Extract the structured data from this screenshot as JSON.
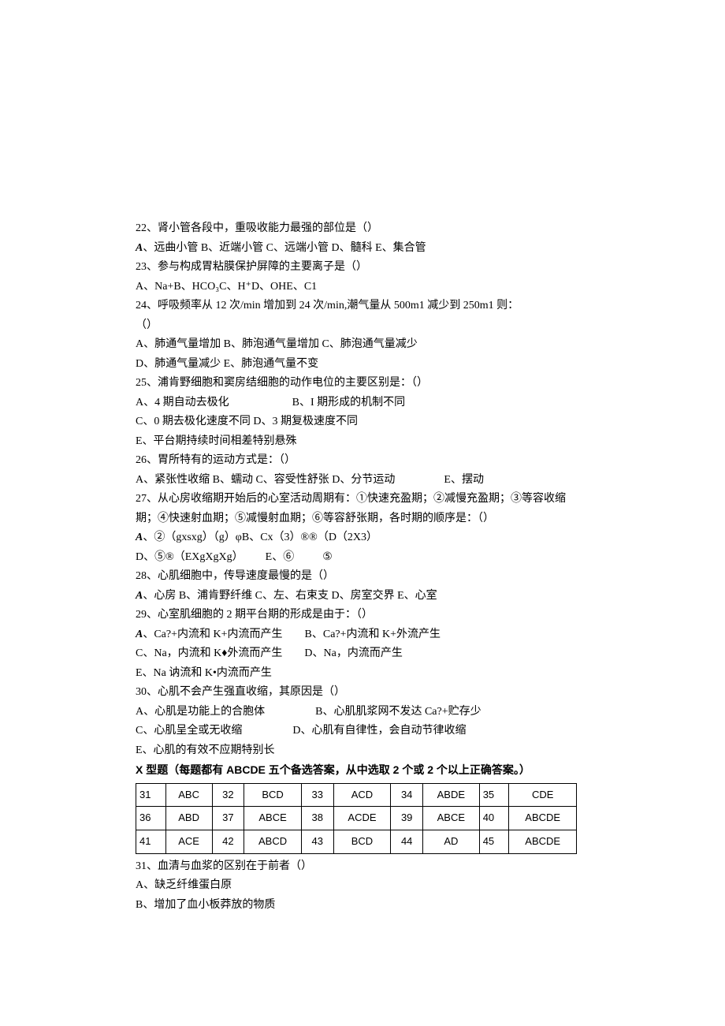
{
  "q22": {
    "text": "22、肾小管各段中，重吸收能力最强的部位是（）",
    "opts": "、远曲小管 B、近端小管 C、远端小管 D、髓科 E、集合管"
  },
  "q23": {
    "text": "23、参与构成胃粘膜保护屏障的主要离子是（）",
    "opts": "A、Na+B、HCO₃C、H⁺D、OHE、C1"
  },
  "q24": {
    "text": "24、呼吸频率从 12 次/min 增加到 24 次/min,潮气量从 500m1 减少到 250m1 则：",
    "text2": "（）",
    "opts1": "A、肺通气量增加 B、肺泡通气量增加 C、肺泡通气量减少",
    "opts2": "D、肺通气量减少 E、肺泡通气量不变"
  },
  "q25": {
    "text": "25、浦肯野细胞和窦房结细胞的动作电位的主要区别是：（）",
    "a": "A、4 期自动去极化",
    "b": "B、I 期形成的机制不同",
    "c": "C、0 期去极化速度不同 D、3 期复极速度不同",
    "e": "E、平台期持续时间相差特别悬殊"
  },
  "q26": {
    "text": "26、胃所特有的运动方式是：（）",
    "opts": "A、紧张性收缩 B、蠕动 C、容受性舒张 D、分节运动",
    "e": "E、摆动"
  },
  "q27": {
    "text1": "27、从心房收缩期开始后的心室活动周期有：①快速充盈期；②减慢充盈期；③等容收缩",
    "text2": "期；④快速射血期；⑤减慢射血期；⑥等容舒张期，各时期的顺序是：（）",
    "a": "、②（gxsxg）（g）φB、Cx（3）®®（D（2X3）",
    "d": "D、⑤®（EXgXgXg）",
    "e": "E、⑥",
    "f": "⑤"
  },
  "q28": {
    "text": "28、心肌细胞中，传导速度最慢的是（）",
    "opts": "、心房 B、浦肯野纤维 C、左、右束支 D、房室交界 E、心室"
  },
  "q29": {
    "text": "29、心室肌细胞的 2 期平台期的形成是由于：（）",
    "a": "、Ca?+内流和 K+内流而产生",
    "b": "B、Ca?+内流和 K+外流产生",
    "c": "C、Na，内流和 K♦外流而产生",
    "d": "D、Na，内流而产生",
    "e": "E、Na 讷流和 K•内流而产生"
  },
  "q30": {
    "text": "30、心肌不会产生强直收缩，其原因是（）",
    "a": "A、心肌是功能上的合胞体",
    "b": "B、心肌肌浆网不发达 Ca?+贮存少",
    "c": "C、心肌呈全或无收缩",
    "d": "D、心肌有自律性，会自动节律收缩",
    "e": "E、心肌的有效不应期特别长"
  },
  "xheading": "X 型题（每题都有 ABCDE 五个备选答案，从中选取 2 个或 2 个以上正确答案。）",
  "table": {
    "r1": [
      "31",
      "ABC",
      "32",
      "BCD",
      "33",
      "ACD",
      "34",
      "ABDE",
      "35",
      "CDE"
    ],
    "r2": [
      "36",
      "ABD",
      "37",
      "ABCE",
      "38",
      "ACDE",
      "39",
      "ABCE",
      "40",
      "ABCDE"
    ],
    "r3": [
      "41",
      "ACE",
      "42",
      "ABCD",
      "43",
      "BCD",
      "44",
      "AD",
      "45",
      "ABCDE"
    ]
  },
  "q31": {
    "text": "31、血清与血浆的区别在于前者（）",
    "a": "A、缺乏纤维蛋白原",
    "b": "B、增加了血小板莽放的物质"
  }
}
